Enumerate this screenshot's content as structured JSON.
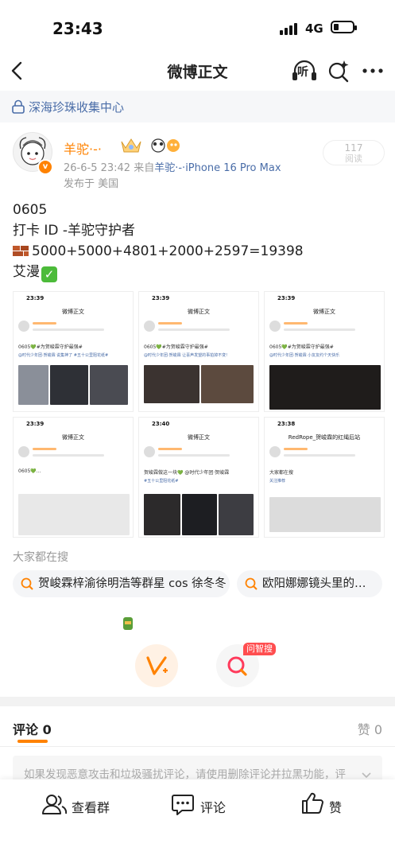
{
  "status_bar": {
    "time": "23:43",
    "network": "4G"
  },
  "nav": {
    "title": "微博正文",
    "listen_label": "听"
  },
  "group": {
    "name": "深海珍珠收集中心"
  },
  "post": {
    "author": "羊驼·-·",
    "timestamp": "26-6-5 23:42",
    "source_prefix": "来自",
    "source_name": "羊驼·-·",
    "device": "iPhone 16 Pro Max",
    "region": "发布于 美国",
    "reads": {
      "count": "117",
      "label": "阅读"
    },
    "lines": [
      "0605",
      "打卡 ID -羊驼守护者",
      "5000+5000+4801+2000+2597=19398",
      "艾漫"
    ]
  },
  "images": [
    {
      "time": "23:39",
      "title": "微博正文",
      "text": "0605💚#为贺峻霖守护最强#",
      "sub": "@时代少年团·贺峻霖 说集神了 #五十公里阻花纸#"
    },
    {
      "time": "23:39",
      "title": "微博正文",
      "text": "0605💚#为贺峻霖守护最强#",
      "sub": "@时代少年团·贺峻霖 让喜声发望的事拍掉不变!"
    },
    {
      "time": "23:39",
      "title": "微博正文",
      "text": "0605💚#为贺峻霖守护最强#",
      "sub": "@时代少年团·贺峻霖 小友友约个天快乐"
    },
    {
      "time": "23:39",
      "title": "微博正文",
      "text": "0605💚...",
      "sub": ""
    },
    {
      "time": "23:40",
      "title": "微博正文",
      "text": "贺峻霖做这一块💚 @时代少年团·贺峻霖",
      "sub": "#五十公里阻花纸#"
    },
    {
      "time": "23:38",
      "title": "RedRope_贺峻霖的红绳后站",
      "text": "大家都在搜",
      "sub": "关注推荐"
    }
  ],
  "everyone_search": {
    "title": "大家都在搜",
    "chips": [
      "贺峻霖梓渝徐明浩等群星 cos 徐冬冬",
      "欧阳娜娜镜头里的…"
    ]
  },
  "floats": {
    "ask_badge": "问智搜"
  },
  "tabs": {
    "comment_label": "评论",
    "comment_count": "0",
    "like_label": "赞",
    "like_count": "0"
  },
  "notice": "如果发现恶意攻击和垃圾骚扰评论，请使用删除评论并拉黑功能，评",
  "bottom_bar": {
    "group_label": "查看群",
    "comment_label": "评论",
    "like_label": "赞"
  },
  "colors": {
    "accent": "#ff8200",
    "link": "#4a6da8"
  }
}
